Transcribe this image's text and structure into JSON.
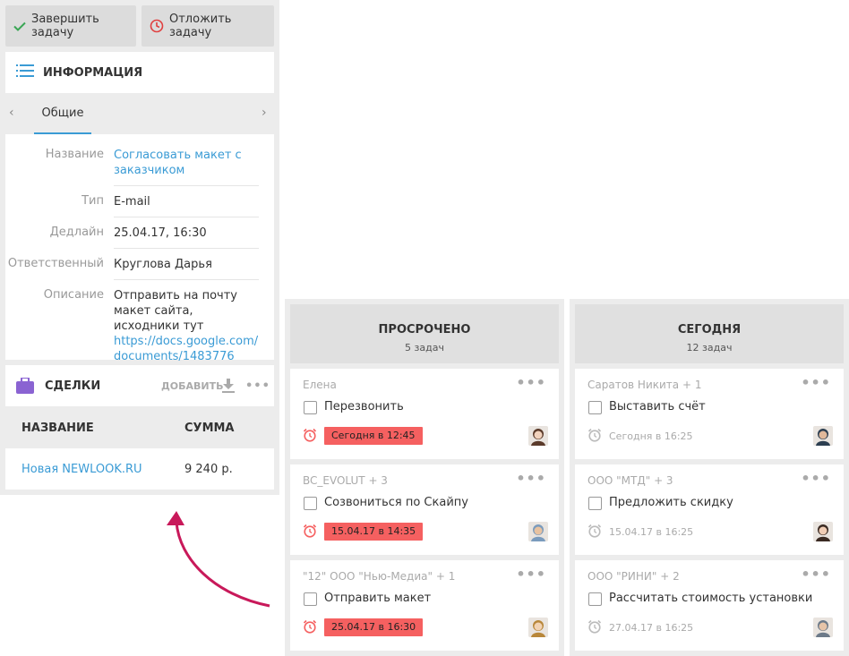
{
  "toolbar": {
    "complete_label": "Завершить задачу",
    "postpone_label": "Отложить задачу"
  },
  "info": {
    "title": "ИНФОРМАЦИЯ",
    "tab": "Общие",
    "fields": [
      {
        "label": "Название",
        "value": "Согласовать макет с заказчиком"
      },
      {
        "label": "Тип",
        "value": "E-mail"
      },
      {
        "label": "Дедлайн",
        "value": "25.04.17, 16:30"
      },
      {
        "label": "Ответственный",
        "value": "Круглова Дарья"
      },
      {
        "label": "Описание",
        "value": "Отправить на почту макет сайта, исходники тут",
        "link": "https://docs.google.com/documents/1483776"
      }
    ]
  },
  "deals": {
    "title": "СДЕЛКИ",
    "add_label": "ДОБАВИТЬ",
    "col_name": "НАЗВАНИЕ",
    "col_sum": "СУММА",
    "rows": [
      {
        "name": "Новая NEWLOOK.RU",
        "sum": "9 240 р."
      }
    ]
  },
  "columns": [
    {
      "title": "ПРОСРОЧЕНО",
      "count": "5 задач",
      "cards": [
        {
          "meta": "Елена",
          "text": "Перезвонить",
          "due": "Сегодня в 12:45",
          "overdue": true
        },
        {
          "meta": "BC_EVOLUT + 3",
          "text": "Созвониться по Скайпу",
          "due": "15.04.17 в 14:35",
          "overdue": true
        },
        {
          "meta": "\"12\" ООО \"Нью-Медиа\" + 1",
          "text": "Отправить макет",
          "due": "25.04.17 в 16:30",
          "overdue": true
        }
      ]
    },
    {
      "title": "СЕГОДНЯ",
      "count": "12 задач",
      "cards": [
        {
          "meta": "Саратов Никита + 1",
          "text": "Выставить счёт",
          "due": "Сегодня в 16:25",
          "overdue": false
        },
        {
          "meta": "ООО \"МТД\" + 3",
          "text": "Предложить скидку",
          "due": "15.04.17 в 16:25",
          "overdue": false
        },
        {
          "meta": "ООО \"РИНИ\" + 2",
          "text": "Рассчитать стоимость установки",
          "due": "27.04.17 в 16:25",
          "overdue": false
        }
      ]
    }
  ],
  "colors": {
    "accent": "#3a9bd5",
    "overdue": "#f56060",
    "arrow": "#c8195a",
    "deals_icon": "#8a63d2"
  },
  "icons": {
    "more": "•••"
  }
}
